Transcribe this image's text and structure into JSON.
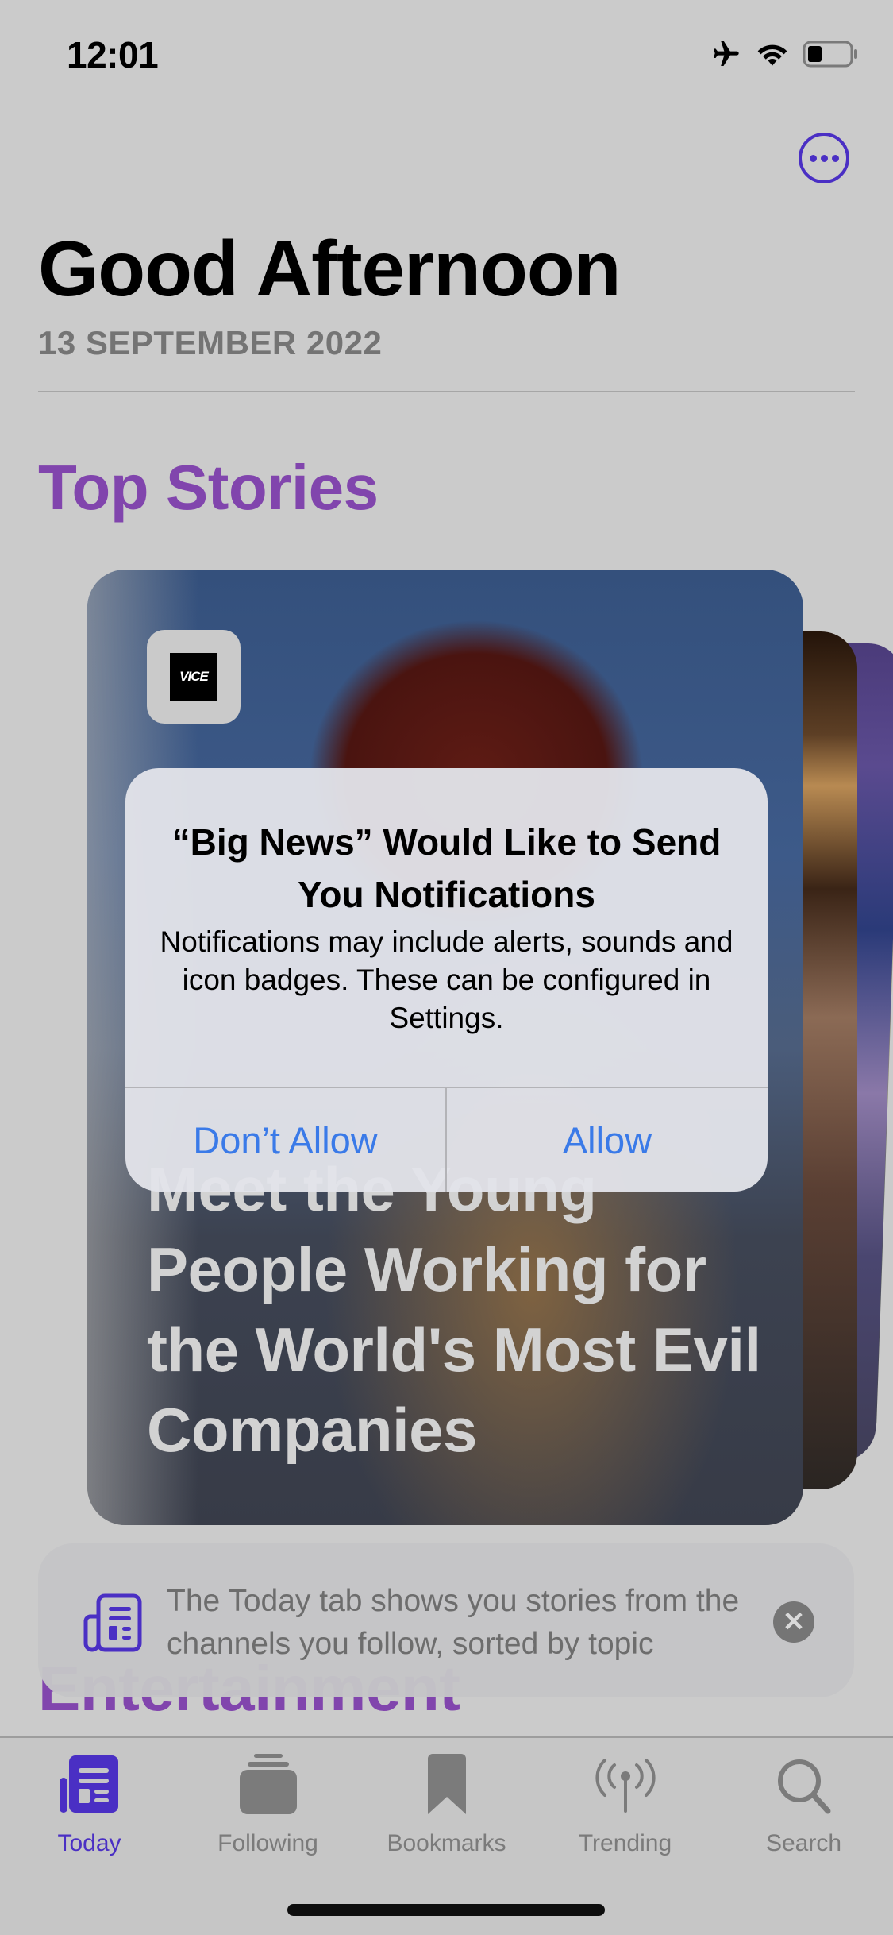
{
  "status_bar": {
    "time": "12:01",
    "icons": [
      "airplane-icon",
      "wifi-icon",
      "battery-icon"
    ],
    "battery_level": 0.3
  },
  "header": {
    "more_button": "more-icon",
    "greeting": "Good Afternoon",
    "date": "13 SEPTEMBER 2022"
  },
  "sections": {
    "top_stories": "Top Stories",
    "next_section": "Entertainment"
  },
  "story": {
    "publisher": "VICE",
    "headline": "Meet the Young People Working for the World's Most Evil Companies"
  },
  "alert": {
    "title": "“Big News” Would Like to Send You Notifications",
    "message": "Notifications may include alerts, sounds and icon badges. These can be configured in Settings.",
    "buttons": {
      "deny": "Don’t Allow",
      "allow": "Allow"
    }
  },
  "tip": {
    "icon": "newspaper-icon",
    "text": "The Today tab shows you stories from the channels you follow, sorted by topic",
    "close": "✕"
  },
  "tabbar": {
    "items": [
      {
        "label": "Today",
        "icon": "today-icon",
        "active": true
      },
      {
        "label": "Following",
        "icon": "following-icon",
        "active": false
      },
      {
        "label": "Bookmarks",
        "icon": "bookmark-icon",
        "active": false
      },
      {
        "label": "Trending",
        "icon": "trending-icon",
        "active": false
      },
      {
        "label": "Search",
        "icon": "search-icon",
        "active": false
      }
    ]
  },
  "colors": {
    "accent": "#4a2fc4",
    "section_title": "#8145ad",
    "alert_button": "#3a7ae8",
    "background": "#cbcbcb"
  }
}
